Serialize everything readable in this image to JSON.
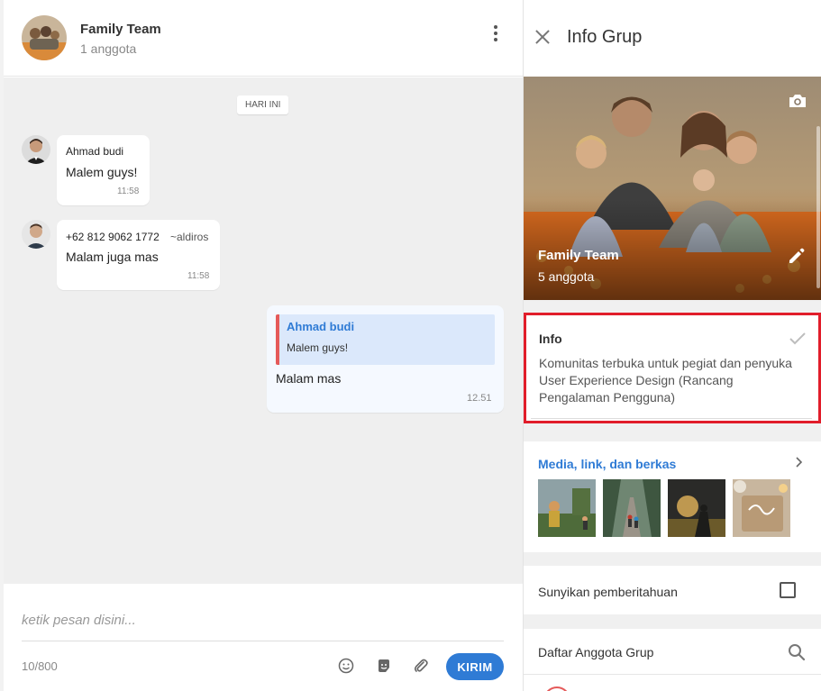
{
  "chat": {
    "header": {
      "title": "Family Team",
      "subtitle": "1 anggota"
    },
    "day_label": "HARI INI",
    "messages": [
      {
        "sender": "Ahmad budi",
        "text": "Malem guys!",
        "time": "11:58"
      },
      {
        "sender": "+62 812 9062 1772",
        "tag": "~aldiros",
        "text": "Malam juga mas",
        "time": "11:58"
      },
      {
        "quote_sender": "Ahmad budi",
        "quote_text": "Malem guys!",
        "text": "Malam mas",
        "time": "12.51"
      }
    ],
    "composer": {
      "placeholder": "ketik pesan disini...",
      "counter": "10/800",
      "send_label": "KIRIM"
    }
  },
  "info": {
    "title": "Info Grup",
    "group_name": "Family Team",
    "group_members": "5 anggota",
    "description_label": "Info",
    "description": "Komunitas terbuka untuk pegiat dan penyuka User Experience Design (Rancang Pengalaman Pengguna)",
    "media_title": "Media, link, dan berkas",
    "mute_label": "Sunyikan pemberitahuan",
    "members_label": "Daftar Anggota Grup"
  },
  "colors": {
    "accent": "#2f7bd5",
    "highlight": "#e11d2a",
    "quote_bar": "#e55a5a"
  },
  "icons": [
    "kebab-menu-icon",
    "close-icon",
    "camera-icon",
    "pencil-icon",
    "check-icon",
    "chevron-right-icon",
    "emoji-icon",
    "sticker-icon",
    "paperclip-icon",
    "search-icon"
  ]
}
